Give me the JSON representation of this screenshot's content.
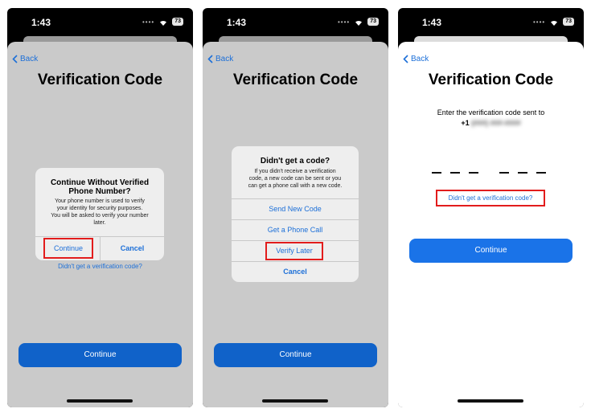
{
  "status": {
    "time": "1:43",
    "battery": "73"
  },
  "back_label": "Back",
  "title": "Verification Code",
  "continue_label": "Continue",
  "link_label": "Didn't get a verification code?",
  "screen1": {
    "alert": {
      "title_line1": "Continue Without Verified",
      "title_line2": "Phone Number?",
      "message_line1": "Your phone number is used to verify",
      "message_line2": "your identity for security purposes.",
      "message_line3": "You will be asked to verify your number",
      "message_line4": "later.",
      "continue": "Continue",
      "cancel": "Cancel"
    }
  },
  "screen2": {
    "sheet": {
      "title": "Didn't get a code?",
      "message_line1": "If you didn't receive a verification",
      "message_line2": "code, a new code can be sent or you",
      "message_line3": "can get a phone call with a new code.",
      "send_new": "Send New Code",
      "phone_call": "Get a Phone Call",
      "verify_later": "Verify Later",
      "cancel": "Cancel"
    }
  },
  "screen3": {
    "prompt_line1": "Enter the verification code sent to",
    "phone_prefix": "+1",
    "phone_masked": "(###) ###-####"
  },
  "colors": {
    "accent": "#1062c9",
    "link": "#1c6fd8",
    "highlight": "#e21c1c"
  }
}
